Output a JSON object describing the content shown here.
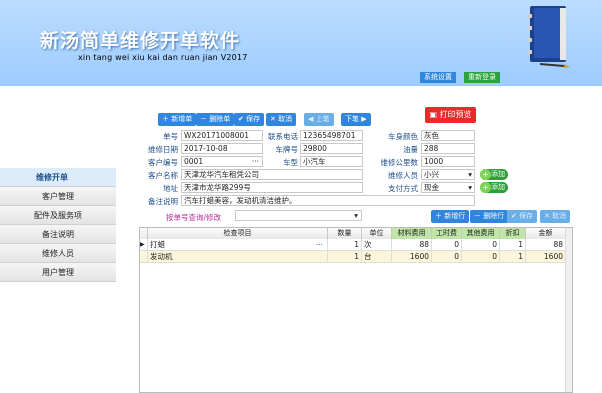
{
  "app": {
    "title": "新汤简单维修开单软件",
    "subtitle": "xin tang wei xiu kai dan ruan jian  V2017"
  },
  "top_buttons": {
    "settings": "系统设置",
    "relogin": "重新登录"
  },
  "sidebar": {
    "items": [
      {
        "label": "维修开单",
        "active": true
      },
      {
        "label": "客户管理"
      },
      {
        "label": "配件及服务项"
      },
      {
        "label": "备注说明"
      },
      {
        "label": "维修人员"
      },
      {
        "label": "用户管理"
      }
    ]
  },
  "toolbar": {
    "new": "新增单",
    "delete": "删除单",
    "save": "保存",
    "cancel": "取消",
    "prev": "上笔",
    "next": "下笔",
    "print": "打印预览"
  },
  "form": {
    "order_no": {
      "label": "单号",
      "value": "WX20171008001"
    },
    "phone": {
      "label": "联系电话",
      "value": "12365498701"
    },
    "color": {
      "label": "车身颜色",
      "value": "灰色"
    },
    "date": {
      "label": "维修日期",
      "value": "2017-10-08"
    },
    "plate": {
      "label": "车牌号",
      "value": "29800"
    },
    "fuel": {
      "label": "油量",
      "value": "288"
    },
    "cust_no": {
      "label": "客户编号",
      "value": "0001"
    },
    "model": {
      "label": "车型",
      "value": "小汽车"
    },
    "mileage": {
      "label": "维修公里数",
      "value": "1000"
    },
    "cust_name": {
      "label": "客户名称",
      "value": "天津龙华汽车租凭公司"
    },
    "worker": {
      "label": "维修人员",
      "value": "小兴"
    },
    "address": {
      "label": "地址",
      "value": "天津市龙华路299号"
    },
    "payment": {
      "label": "支付方式",
      "value": "现金"
    },
    "remark": {
      "label": "备注说明",
      "value": "汽车打蜡美容，发动机清洁维护。"
    },
    "add_btn": "添加"
  },
  "query": {
    "label": "按单号查询/修改",
    "value": ""
  },
  "row_toolbar": {
    "add": "新增行",
    "delete": "删除行",
    "save": "保存",
    "cancel": "取消"
  },
  "table": {
    "columns": [
      "检查项目",
      "数量",
      "单位",
      "材料费用",
      "工时费",
      "其他费用",
      "折扣",
      "金额"
    ],
    "rows": [
      [
        "打蜡",
        "1",
        "次",
        "88",
        "0",
        "0",
        "1",
        "88"
      ],
      [
        "发动机",
        "1",
        "台",
        "1600",
        "0",
        "0",
        "1",
        "1600"
      ]
    ]
  },
  "colors": {
    "header_bg": "#9cccff",
    "accent_blue": "#2f86dc",
    "print_red": "#e82a2a",
    "add_green": "#2ea03a",
    "table_header_green": "#bfe6a8"
  }
}
